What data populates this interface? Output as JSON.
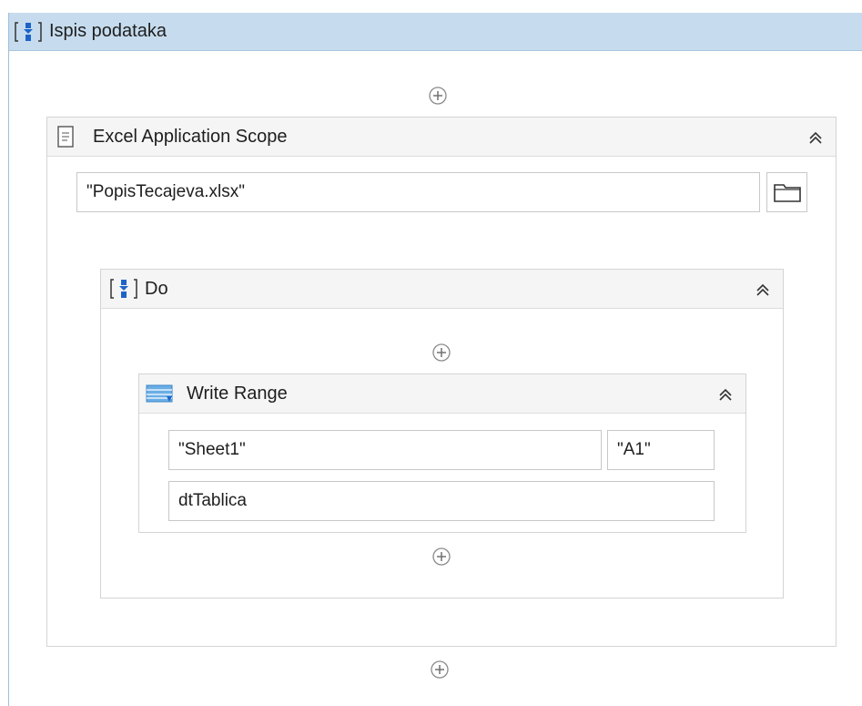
{
  "outer_sequence": {
    "title": "Ispis podataka",
    "icon": "sequence-icon"
  },
  "excel_scope": {
    "title": "Excel Application Scope",
    "icon": "document-icon",
    "workbook_path": "\"PopisTecajeva.xlsx\""
  },
  "do_sequence": {
    "title": "Do",
    "icon": "sequence-icon"
  },
  "write_range": {
    "title": "Write Range",
    "icon": "table-icon",
    "sheet_name": "\"Sheet1\"",
    "start_cell": "\"A1\"",
    "data_table": "dtTablica"
  },
  "colors": {
    "header_blue": "#c6dcee",
    "activity_header": "#f5f5f5",
    "icon_blue": "#1e64c8"
  }
}
